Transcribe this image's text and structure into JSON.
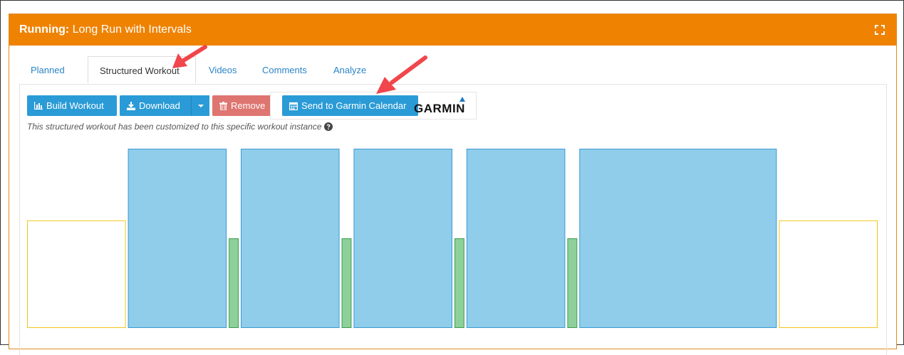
{
  "header": {
    "sport": "Running:",
    "title": " Long Run with Intervals",
    "color": "#ef8200"
  },
  "tabs": [
    {
      "label": "Planned",
      "active": false
    },
    {
      "label": "Structured Workout",
      "active": true
    },
    {
      "label": "Videos",
      "active": false
    },
    {
      "label": "Comments",
      "active": false
    },
    {
      "label": "Analyze",
      "active": false
    }
  ],
  "toolbar": {
    "build_label": "Build Workout",
    "download_label": "Download",
    "remove_label": "Remove",
    "garmin_label": "Send to Garmin Calendar",
    "garmin_logo": "GARMIN"
  },
  "note": "This structured workout has been customized to this specific workout instance",
  "workout_chart": {
    "steps": [
      {
        "type": "warmup",
        "duration": 10,
        "intensity": 0.6
      },
      {
        "type": "interval",
        "duration": 10,
        "intensity": 1.0
      },
      {
        "type": "recovery",
        "duration": 1,
        "intensity": 0.5
      },
      {
        "type": "interval",
        "duration": 10,
        "intensity": 1.0
      },
      {
        "type": "recovery",
        "duration": 1,
        "intensity": 0.5
      },
      {
        "type": "interval",
        "duration": 10,
        "intensity": 1.0
      },
      {
        "type": "recovery",
        "duration": 1,
        "intensity": 0.5
      },
      {
        "type": "interval",
        "duration": 10,
        "intensity": 1.0
      },
      {
        "type": "recovery",
        "duration": 1,
        "intensity": 0.5
      },
      {
        "type": "interval",
        "duration": 20,
        "intensity": 1.0
      },
      {
        "type": "cooldown",
        "duration": 10,
        "intensity": 0.6
      }
    ],
    "colors": {
      "warmup": "#f0c419",
      "interval": "#8fcdeb",
      "interval_border": "#3b9bd1",
      "recovery": "#8ed09a",
      "recovery_border": "#3a9c4e",
      "cooldown": "#f0c419"
    }
  }
}
